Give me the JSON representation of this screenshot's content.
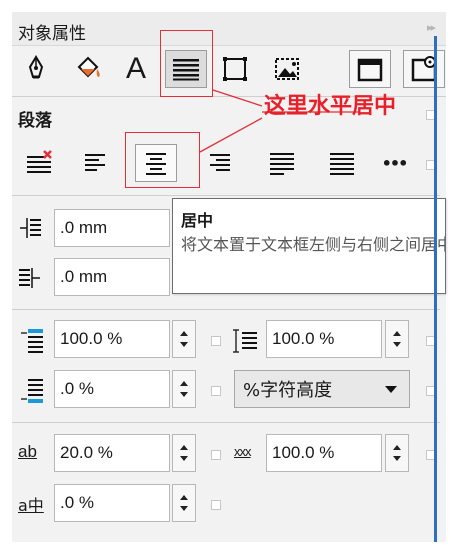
{
  "panel": {
    "title": "对象属性",
    "expand_glyph": "▸▸"
  },
  "toolbar": {
    "icons": [
      "pen-nib-icon",
      "fill-bucket-icon",
      "character-icon",
      "paragraph-icon",
      "frame-icon",
      "image-frame-icon",
      "text-frame-icon",
      "text-frame-settings-icon"
    ],
    "character_glyph": "A"
  },
  "paragraph": {
    "section_label": "段落",
    "alignment_buttons": [
      "align-none",
      "align-left",
      "align-center",
      "align-right",
      "justify",
      "force-justify",
      "more"
    ],
    "more_glyph": "•••"
  },
  "annotation": {
    "text": "这里水平居中",
    "color": "#e8202a"
  },
  "tooltip": {
    "title": "居中",
    "body": "将文本置于文本框左侧与右侧之间居中位置。"
  },
  "indent": {
    "first_line": {
      "value": ".0 mm"
    },
    "left": {
      "value": ".0 mm"
    }
  },
  "spacing": {
    "before_paragraph": {
      "value": "100.0 %"
    },
    "line_spacing": {
      "value": "100.0 %"
    },
    "after_paragraph": {
      "value": ".0 %"
    },
    "unit_dropdown": {
      "value": "%字符高度"
    }
  },
  "char_spacing": {
    "char_spacing_label": "ab",
    "char_spacing": {
      "value": "20.0 %"
    },
    "word_spacing_glyph": "xxx",
    "word_spacing": {
      "value": "100.0 %"
    },
    "language_spacing_label": "a中",
    "language_spacing": {
      "value": ".0 %"
    }
  },
  "colors": {
    "accent_blue": "#2f6fbf",
    "highlight_red": "#e0303a"
  }
}
